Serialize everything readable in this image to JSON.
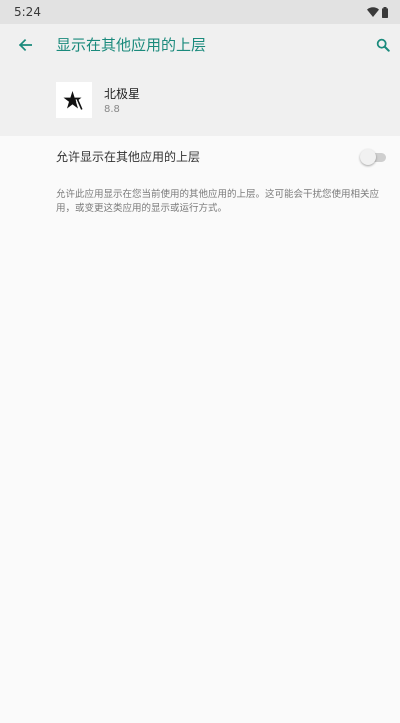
{
  "status_bar": {
    "time": "5:24",
    "icons": [
      "wifi-icon",
      "battery-icon"
    ]
  },
  "app_bar": {
    "title": "显示在其他应用的上层",
    "back_icon": "arrow-back-icon",
    "search_icon": "search-icon"
  },
  "app_info": {
    "name": "北极星",
    "version": "8.8"
  },
  "setting": {
    "label": "允许显示在其他应用的上层",
    "enabled": false
  },
  "description": "允许此应用显示在您当前使用的其他应用的上层。这可能会干扰您使用相关应用，或变更这类应用的显示或运行方式。",
  "colors": {
    "accent": "#1a8a7c",
    "status_bar_bg": "#e2e2e2",
    "header_bg": "#f0f0f0",
    "page_bg": "#fafafa"
  }
}
